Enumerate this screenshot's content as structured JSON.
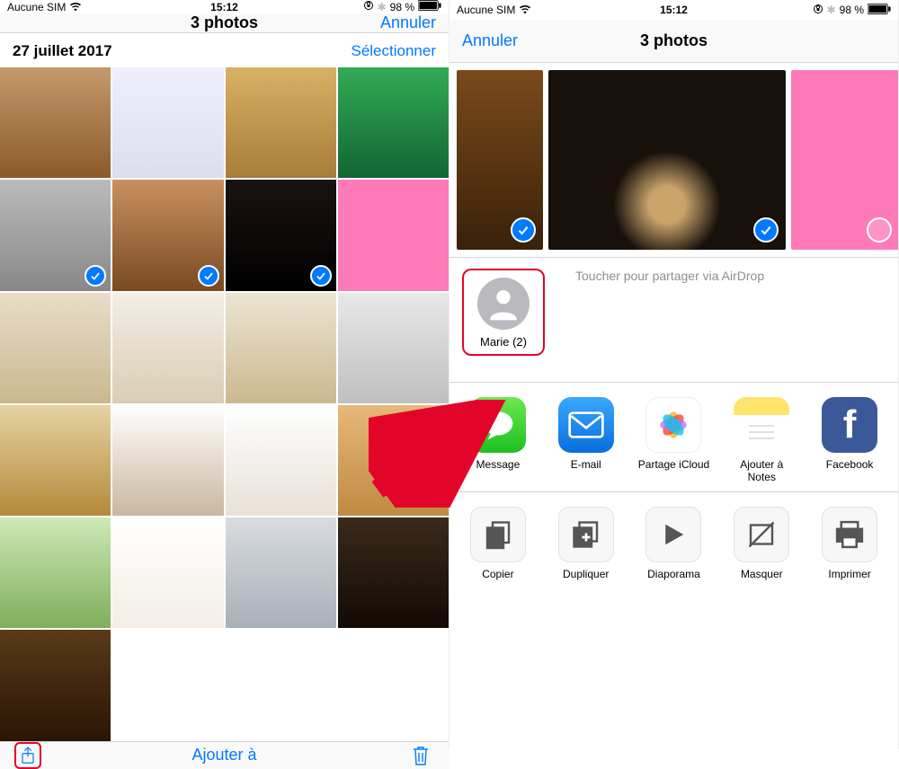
{
  "status": {
    "carrier": "Aucune SIM",
    "time": "15:12",
    "battery": "98 %"
  },
  "left": {
    "nav": {
      "title": "3 photos",
      "cancel": "Annuler"
    },
    "section": {
      "date": "27 juillet 2017",
      "select": "Sélectionner"
    },
    "toolbar": {
      "add_to": "Ajouter à"
    },
    "selected_indices": [
      4,
      5,
      6
    ]
  },
  "right": {
    "nav": {
      "title": "3 photos",
      "cancel": "Annuler"
    },
    "airdrop": {
      "hint": "Toucher pour partager via AirDrop",
      "contact": "Marie (2)"
    },
    "apps": [
      {
        "id": "message",
        "label": "Message"
      },
      {
        "id": "email",
        "label": "E-mail"
      },
      {
        "id": "icloud",
        "label": "Partage iCloud"
      },
      {
        "id": "notes",
        "label": "Ajouter à Notes"
      },
      {
        "id": "facebook",
        "label": "Facebook"
      }
    ],
    "actions": [
      {
        "id": "copy",
        "label": "Copier"
      },
      {
        "id": "duplicate",
        "label": "Dupliquer"
      },
      {
        "id": "slideshow",
        "label": "Diaporama"
      },
      {
        "id": "hide",
        "label": "Masquer"
      },
      {
        "id": "print",
        "label": "Imprimer"
      }
    ]
  }
}
